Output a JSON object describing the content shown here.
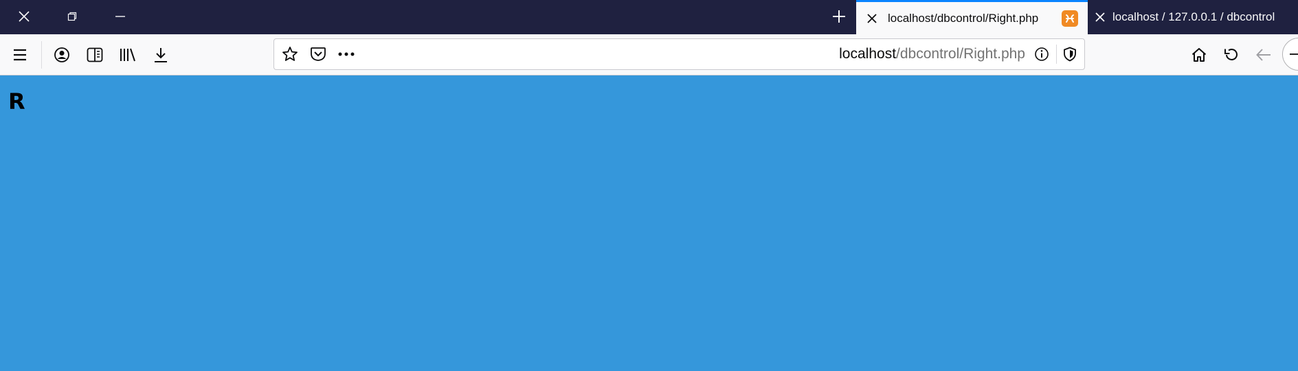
{
  "window": {
    "controls": [
      {
        "name": "close",
        "icon": "close-icon"
      },
      {
        "name": "restore",
        "icon": "restore-icon"
      },
      {
        "name": "minimize",
        "icon": "minimize-icon"
      }
    ]
  },
  "tabs": [
    {
      "title": "localhost/dbcontrol/Right.php",
      "active": true,
      "favicon": "xampp-icon",
      "favicon_color": "#f08a24"
    },
    {
      "title": "localhost / 127.0.0.1 / dbcontrol",
      "active": false
    }
  ],
  "toolbar": {
    "left_icons": [
      "menu-icon",
      "account-icon",
      "sidebar-icon",
      "library-icon",
      "download-icon"
    ],
    "right_icons": [
      "home-icon",
      "reload-icon",
      "back-icon"
    ]
  },
  "urlbar": {
    "host": "localhost",
    "path": "/dbcontrol/Right.php",
    "icons": [
      "bookmark-star-icon",
      "pocket-icon",
      "page-actions-icon",
      "info-icon",
      "tracking-protection-icon"
    ]
  },
  "page": {
    "heading": "R",
    "background_color": "#3597db"
  },
  "colors": {
    "titlebar": "#1f2140",
    "active_tab_accent": "#0a84ff",
    "toolbar": "#f9f9fa"
  }
}
